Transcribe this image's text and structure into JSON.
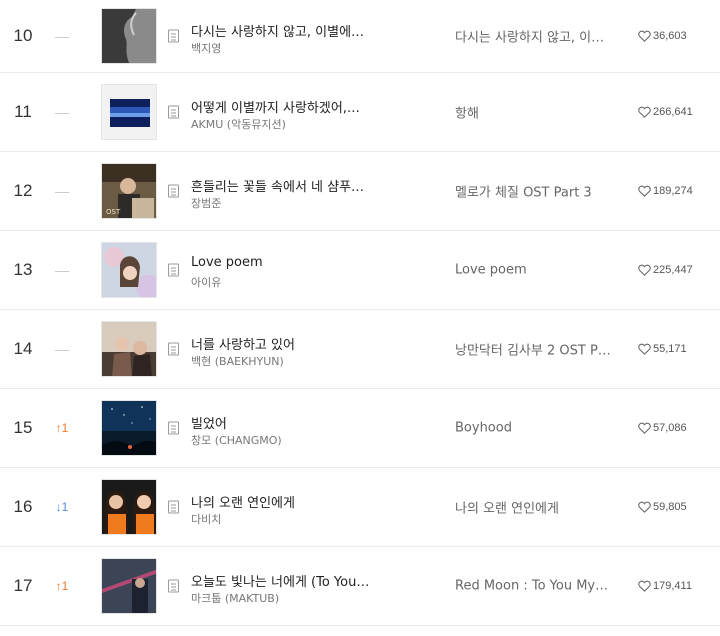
{
  "songs": [
    {
      "rank": "10",
      "change_type": "same",
      "change_arrow": "",
      "change_text": "—",
      "title": "다시는 사랑하지 않고, 이별에…",
      "artist": "백지영",
      "album": "다시는 사랑하지 않고, 이…",
      "likes": "36,603"
    },
    {
      "rank": "11",
      "change_type": "same",
      "change_arrow": "",
      "change_text": "—",
      "title": "어떻게 이별까지 사랑하겠어,…",
      "artist": "AKMU (악동뮤지션)",
      "album": "항해",
      "likes": "266,641"
    },
    {
      "rank": "12",
      "change_type": "same",
      "change_arrow": "",
      "change_text": "—",
      "title": "흔들리는 꽃들 속에서 네 샴푸…",
      "artist": "장범준",
      "album": "멜로가 체질 OST Part 3",
      "likes": "189,274"
    },
    {
      "rank": "13",
      "change_type": "same",
      "change_arrow": "",
      "change_text": "—",
      "title": "Love poem",
      "artist": "아이유",
      "album": "Love poem",
      "likes": "225,447"
    },
    {
      "rank": "14",
      "change_type": "same",
      "change_arrow": "",
      "change_text": "—",
      "title": "너를 사랑하고 있어",
      "artist": "백현 (BAEKHYUN)",
      "album": "낭만닥터 김사부 2 OST P…",
      "likes": "55,171"
    },
    {
      "rank": "15",
      "change_type": "up",
      "change_arrow": "↑",
      "change_text": "1",
      "title": "빌었어",
      "artist": "창모 (CHANGMO)",
      "album": "Boyhood",
      "likes": "57,086"
    },
    {
      "rank": "16",
      "change_type": "down",
      "change_arrow": "↓",
      "change_text": "1",
      "title": "나의 오랜 연인에게",
      "artist": "다비치",
      "album": "나의 오랜 연인에게",
      "likes": "59,805"
    },
    {
      "rank": "17",
      "change_type": "up",
      "change_arrow": "↑",
      "change_text": "1",
      "title": "오늘도 빛나는 너에게 (To You…",
      "artist": "마크툽 (MAKTUB)",
      "album": "Red Moon : To You My…",
      "likes": "179,411"
    }
  ],
  "colors": {
    "up": "#ee7a2c",
    "down": "#4f8ae6",
    "same": "#c8c8c8"
  },
  "icons": {
    "lyric": "lyric-doc-icon",
    "like": "heart-icon"
  }
}
